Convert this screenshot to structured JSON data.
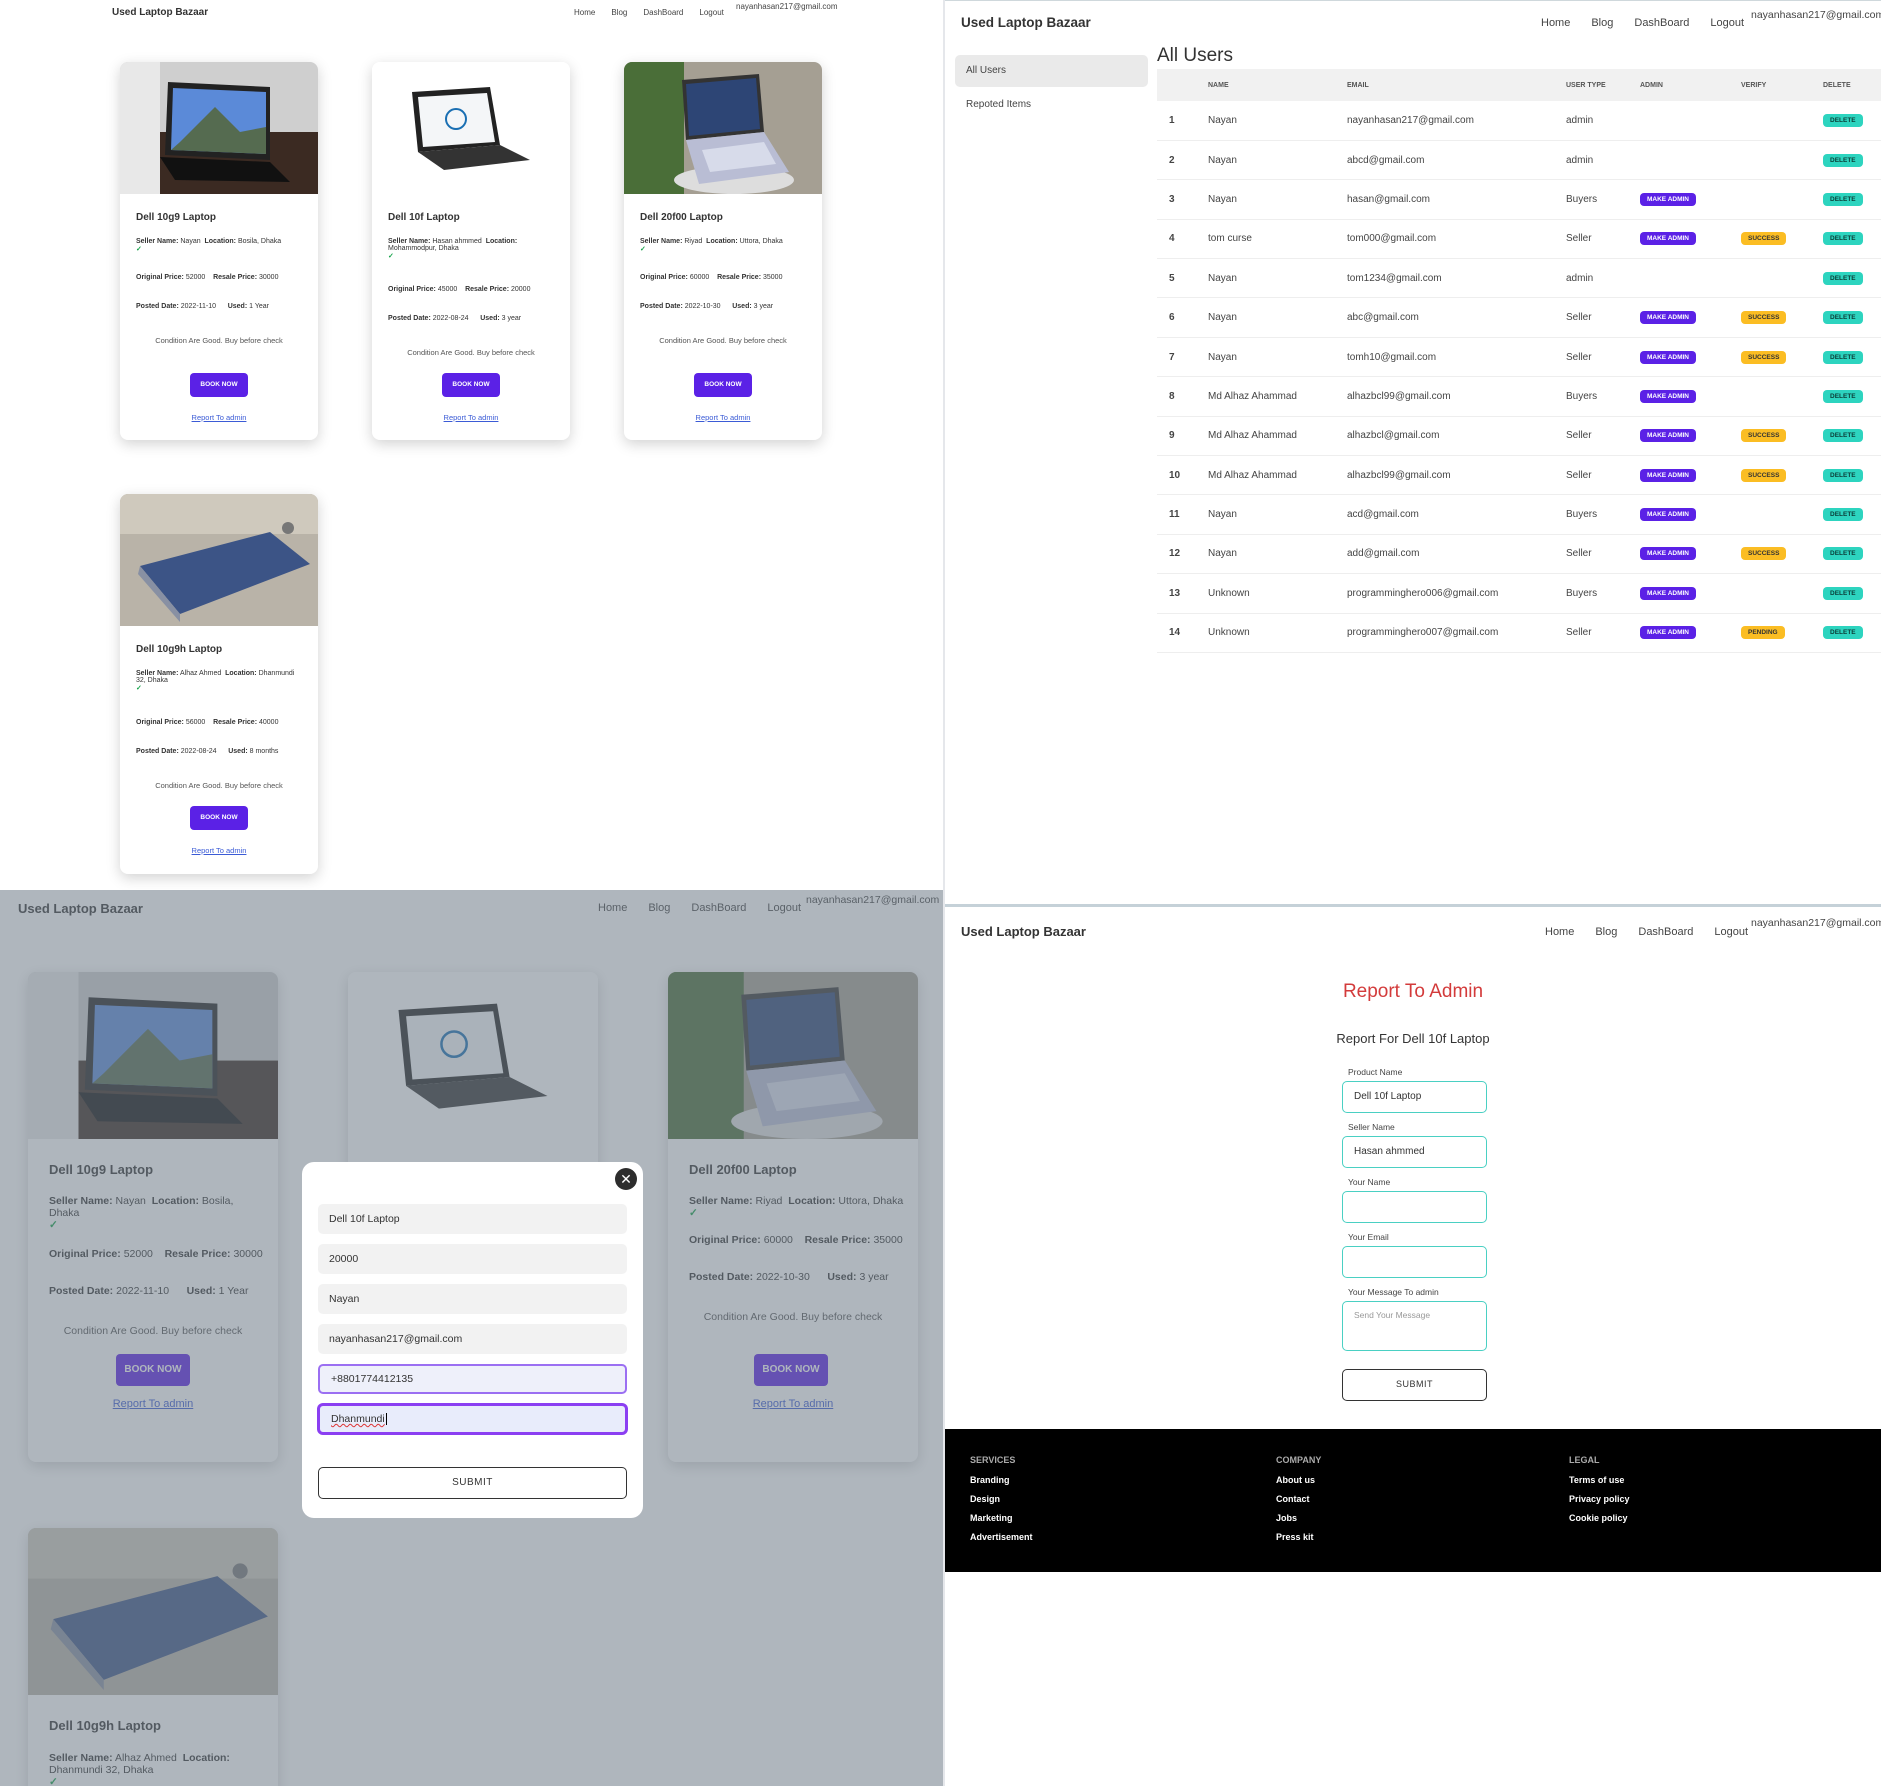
{
  "brand": "Used Laptop Bazaar",
  "nav": {
    "home": "Home",
    "blog": "Blog",
    "dashboard": "DashBoard",
    "logout": "Logout",
    "email": "nayanhasan217@gmail.com"
  },
  "products": [
    {
      "title": "Dell 10g9 Laptop",
      "seller_label": "Seller Name:",
      "seller": "Nayan",
      "location_label": "Location:",
      "location": "Bosila, Dhaka",
      "orig_label": "Original Price:",
      "orig": "52000",
      "resale_label": "Resale Price:",
      "resale": "30000",
      "date_label": "Posted Date:",
      "date": "2022-11-10",
      "used_label": "Used:",
      "used": "1 Year",
      "condition": "Condition Are Good. Buy before check",
      "book": "BOOK NOW",
      "report": "Report To admin"
    },
    {
      "title": "Dell 10f Laptop",
      "seller_label": "Seller Name:",
      "seller": "Hasan ahmmed",
      "location_label": "Location:",
      "location": "Mohammodpur, Dhaka",
      "orig_label": "Original Price:",
      "orig": "45000",
      "resale_label": "Resale Price:",
      "resale": "20000",
      "date_label": "Posted Date:",
      "date": "2022-08-24",
      "used_label": "Used:",
      "used": "3 year",
      "condition": "Condition Are Good. Buy before check",
      "book": "BOOK NOW",
      "report": "Report To admin"
    },
    {
      "title": "Dell 20f00 Laptop",
      "seller_label": "Seller Name:",
      "seller": "Riyad",
      "location_label": "Location:",
      "location": "Uttora, Dhaka",
      "orig_label": "Original Price:",
      "orig": "60000",
      "resale_label": "Resale Price:",
      "resale": "35000",
      "date_label": "Posted Date:",
      "date": "2022-10-30",
      "used_label": "Used:",
      "used": "3 year",
      "condition": "Condition Are Good. Buy before check",
      "book": "BOOK NOW",
      "report": "Report To admin"
    },
    {
      "title": "Dell 10g9h Laptop",
      "seller_label": "Seller Name:",
      "seller": "Alhaz Ahmed",
      "location_label": "Location:",
      "location": "Dhanmundi 32, Dhaka",
      "orig_label": "Original Price:",
      "orig": "56000",
      "resale_label": "Resale Price:",
      "resale": "40000",
      "date_label": "Posted Date:",
      "date": "2022-08-24",
      "used_label": "Used:",
      "used": "8 months",
      "condition": "Condition Are Good. Buy before check",
      "book": "BOOK NOW",
      "report": "Report To admin"
    }
  ],
  "modal": {
    "product": "Dell 10f Laptop",
    "price": "20000",
    "name": "Nayan",
    "email": "nayanhasan217@gmail.com",
    "phone": "+8801774412135",
    "location": "Dhanmundi",
    "submit": "SUBMIT"
  },
  "dashboard": {
    "sidebar": [
      "All Users",
      "Repoted Items"
    ],
    "title": "All Users",
    "columns": [
      "",
      "NAME",
      "EMAIL",
      "USER TYPE",
      "ADMIN",
      "VERIFY",
      "DELETE"
    ],
    "make_admin": "MAKE ADMIN",
    "delete": "DELETE",
    "users": [
      {
        "n": "1",
        "name": "Nayan",
        "email": "nayanhasan217@gmail.com",
        "type": "admin",
        "admin": "",
        "verify": ""
      },
      {
        "n": "2",
        "name": "Nayan",
        "email": "abcd@gmail.com",
        "type": "admin",
        "admin": "",
        "verify": ""
      },
      {
        "n": "3",
        "name": "Nayan",
        "email": "hasan@gmail.com",
        "type": "Buyers",
        "admin": "MAKE ADMIN",
        "verify": ""
      },
      {
        "n": "4",
        "name": "tom curse",
        "email": "tom000@gmail.com",
        "type": "Seller",
        "admin": "MAKE ADMIN",
        "verify": "SUCCESS"
      },
      {
        "n": "5",
        "name": "Nayan",
        "email": "tom1234@gmail.com",
        "type": "admin",
        "admin": "",
        "verify": ""
      },
      {
        "n": "6",
        "name": "Nayan",
        "email": "abc@gmail.com",
        "type": "Seller",
        "admin": "MAKE ADMIN",
        "verify": "SUCCESS"
      },
      {
        "n": "7",
        "name": "Nayan",
        "email": "tomh10@gmail.com",
        "type": "Seller",
        "admin": "MAKE ADMIN",
        "verify": "SUCCESS"
      },
      {
        "n": "8",
        "name": "Md Alhaz Ahammad",
        "email": "alhazbcl99@gmail.com",
        "type": "Buyers",
        "admin": "MAKE ADMIN",
        "verify": ""
      },
      {
        "n": "9",
        "name": "Md Alhaz Ahammad",
        "email": "alhazbcl@gmail.com",
        "type": "Seller",
        "admin": "MAKE ADMIN",
        "verify": "SUCCESS"
      },
      {
        "n": "10",
        "name": "Md Alhaz Ahammad",
        "email": "alhazbcl99@gmail.com",
        "type": "Seller",
        "admin": "MAKE ADMIN",
        "verify": "SUCCESS"
      },
      {
        "n": "11",
        "name": "Nayan",
        "email": "acd@gmail.com",
        "type": "Buyers",
        "admin": "MAKE ADMIN",
        "verify": ""
      },
      {
        "n": "12",
        "name": "Nayan",
        "email": "add@gmail.com",
        "type": "Seller",
        "admin": "MAKE ADMIN",
        "verify": "SUCCESS"
      },
      {
        "n": "13",
        "name": "Unknown",
        "email": "programminghero006@gmail.com",
        "type": "Buyers",
        "admin": "MAKE ADMIN",
        "verify": ""
      },
      {
        "n": "14",
        "name": "Unknown",
        "email": "programminghero007@gmail.com",
        "type": "Seller",
        "admin": "MAKE ADMIN",
        "verify": "PENDING"
      }
    ]
  },
  "report_form": {
    "title": "Report To Admin",
    "subtitle": "Report For Dell 10f Laptop",
    "product_label": "Product Name",
    "product_value": "Dell 10f Laptop",
    "seller_label": "Seller Name",
    "seller_value": "Hasan ahmmed",
    "your_name_label": "Your Name",
    "your_email_label": "Your Email",
    "message_label": "Your Message To admin",
    "message_placeholder": "Send Your Message",
    "submit": "SUBMIT"
  },
  "footer": {
    "services": {
      "heading": "SERVICES",
      "items": [
        "Branding",
        "Design",
        "Marketing",
        "Advertisement"
      ]
    },
    "company": {
      "heading": "COMPANY",
      "items": [
        "About us",
        "Contact",
        "Jobs",
        "Press kit"
      ]
    },
    "legal": {
      "heading": "LEGAL",
      "items": [
        "Terms of use",
        "Privacy policy",
        "Cookie policy"
      ]
    }
  },
  "colors": {
    "primary": "#5b21e6",
    "success": "#fbbd23",
    "delete": "#2dd4bf",
    "report_title": "#d33b3b",
    "input_border": "#4ad0c3"
  }
}
